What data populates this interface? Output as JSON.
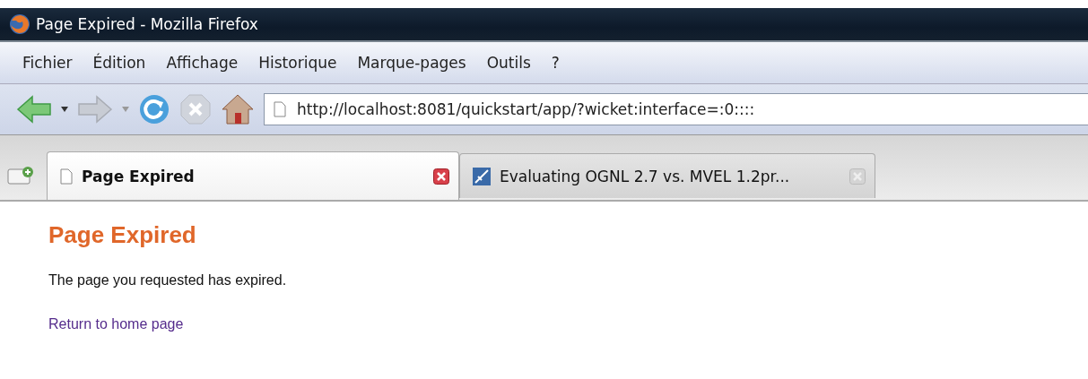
{
  "window": {
    "title": "Page Expired - Mozilla Firefox"
  },
  "menu": [
    "Fichier",
    "Édition",
    "Affichage",
    "Historique",
    "Marque-pages",
    "Outils",
    "?"
  ],
  "address_bar": {
    "value": "http://localhost:8081/quickstart/app/?wicket:interface=:0::::"
  },
  "tabs": [
    {
      "label": "Page Expired",
      "selected": true
    },
    {
      "label": "Evaluating OGNL 2.7 vs. MVEL 1.2pr...",
      "selected": false
    }
  ],
  "page": {
    "heading": "Page Expired",
    "message": "The page you requested has expired.",
    "link": "Return to home page"
  }
}
